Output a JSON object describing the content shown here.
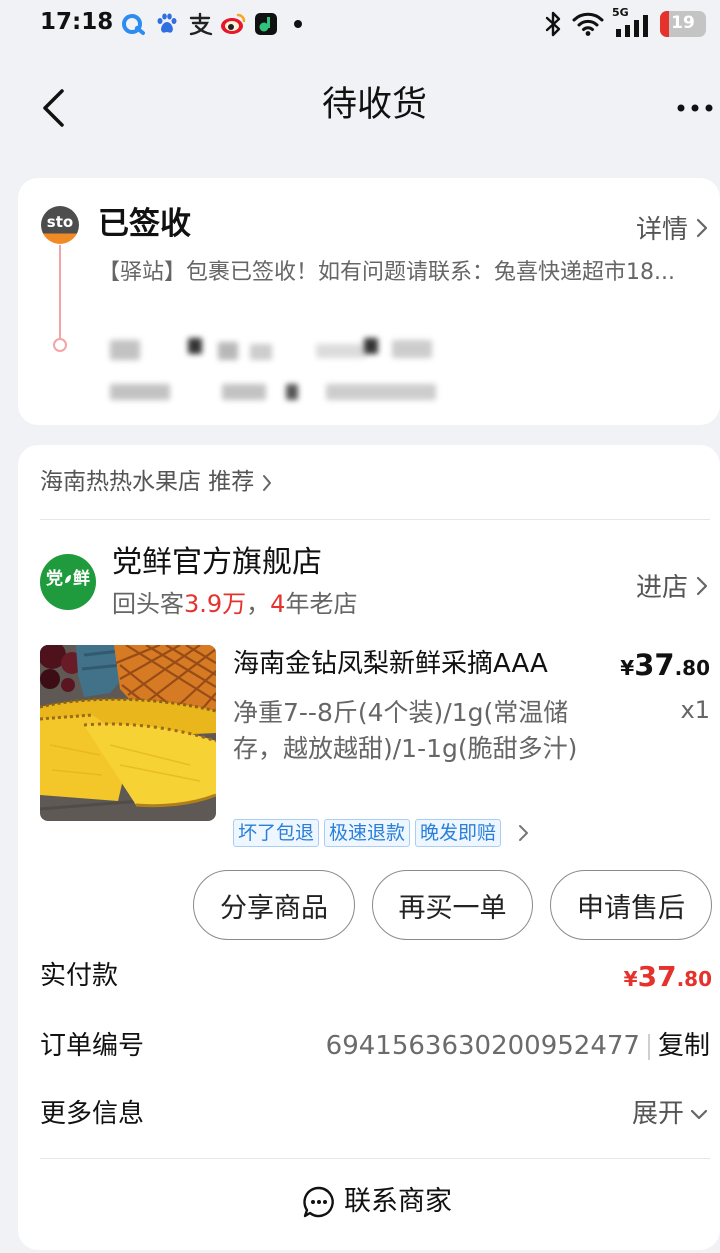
{
  "status_bar": {
    "time": "17:18",
    "network": "5G",
    "battery": "19",
    "battery_level": 0.19
  },
  "nav": {
    "title": "待收货"
  },
  "logistics": {
    "carrier_logo": "sto",
    "status": "已签收",
    "detail_label": "详情",
    "message": "【驿站】包裹已签收！如有问题请联系：兔喜快递超市18..."
  },
  "recommend": {
    "label": "海南热热水果店 推荐"
  },
  "shop": {
    "logo_char_1": "党",
    "logo_char_2": "鲜",
    "name": "党鲜官方旗舰店",
    "stats": {
      "returning_prefix": "回头客",
      "returning_count": "3.9万",
      "separator": "，",
      "years": "4",
      "years_suffix": "年老店"
    },
    "enter_label": "进店"
  },
  "product": {
    "title": "海南金钻凤梨新鲜采摘AAA",
    "spec": "净重7--8斤(4个装)/1g(常温储存，越放越甜)/1-1g(脆甜多汁)",
    "price_symbol": "¥",
    "price_int": "37",
    "price_dec": ".80",
    "quantity": "x1",
    "tags": [
      "坏了包退",
      "极速退款",
      "晚发即赔"
    ]
  },
  "actions": [
    {
      "label": "分享商品"
    },
    {
      "label": "再买一单"
    },
    {
      "label": "申请售后"
    }
  ],
  "payment": {
    "label": "实付款",
    "symbol": "¥",
    "int": "37",
    "dec": ".80"
  },
  "order": {
    "label": "订单编号",
    "number": "6941563630200952477",
    "copy_label": "复制"
  },
  "more_info": {
    "label": "更多信息",
    "toggle_label": "展开"
  },
  "contact": {
    "label": "联系商家"
  },
  "icons": {
    "back": "chevron-left-icon",
    "more": "more-icon",
    "detail": "chevron-right-icon",
    "expand": "chevron-down-icon",
    "contact": "chat-icon",
    "bluetooth": "bluetooth-icon",
    "wifi": "wifi-icon",
    "signal": "signal-icon",
    "battery": "battery-icon"
  },
  "colors": {
    "background": "#f1f2f5",
    "card": "#ffffff",
    "accent_red": "#e5322d",
    "tag_blue": "#2b7fd8",
    "tag_border": "#a9cdf3",
    "tag_bg": "#eef6ff",
    "shop_green": "#1f9a3c",
    "track_red": "#f4a4a4",
    "text_secondary": "#666666"
  }
}
